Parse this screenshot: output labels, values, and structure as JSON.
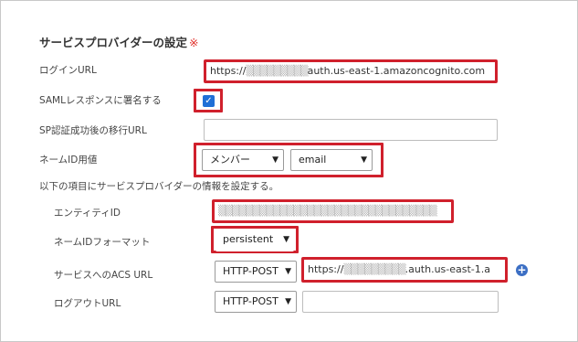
{
  "section": {
    "title": "サービスプロバイダーの設定",
    "required_mark": "※",
    "subtitle": "以下の項目にサービスプロバイダーの情報を設定する。"
  },
  "fields": {
    "login_url": {
      "label": "ログインURL",
      "value_prefix": "https://",
      "value_obscured": "▒▒▒▒▒▒▒▒▒",
      "value_suffix": "auth.us-east-1.amazoncognito.com"
    },
    "saml_sign": {
      "label": "SAMLレスポンスに署名する",
      "checked": true,
      "check_glyph": "✓"
    },
    "sp_redirect_url": {
      "label": "SP認証成功後の移行URL",
      "value": ""
    },
    "name_id": {
      "label": "ネームID用値",
      "select1": "メンバー",
      "select2": "email"
    },
    "entity_id": {
      "label": "エンティティID",
      "value_obscured": "▒▒▒▒▒▒▒▒▒▒▒▒▒▒▒▒▒▒▒▒▒▒▒▒▒▒▒▒▒▒▒▒"
    },
    "name_id_format": {
      "label": "ネームIDフォーマット",
      "value": "persistent"
    },
    "acs_url": {
      "label": "サービスへのACS URL",
      "method": "HTTP-POST",
      "value_prefix": "https://",
      "value_obscured": "▒▒▒▒▒▒▒▒▒",
      "value_suffix": ".auth.us-east-1.a",
      "add_glyph": "+"
    },
    "logout_url": {
      "label": "ログアウトURL",
      "method": "HTTP-POST",
      "value": ""
    }
  },
  "icons": {
    "chevron": "chevron-down-icon",
    "add": "plus-circle-icon",
    "check": "checkmark-icon"
  },
  "colors": {
    "highlight": "#d0202c",
    "checkbox": "#1f6fd6",
    "add_button": "#3c6fc4",
    "required_mark": "#e0312b"
  }
}
